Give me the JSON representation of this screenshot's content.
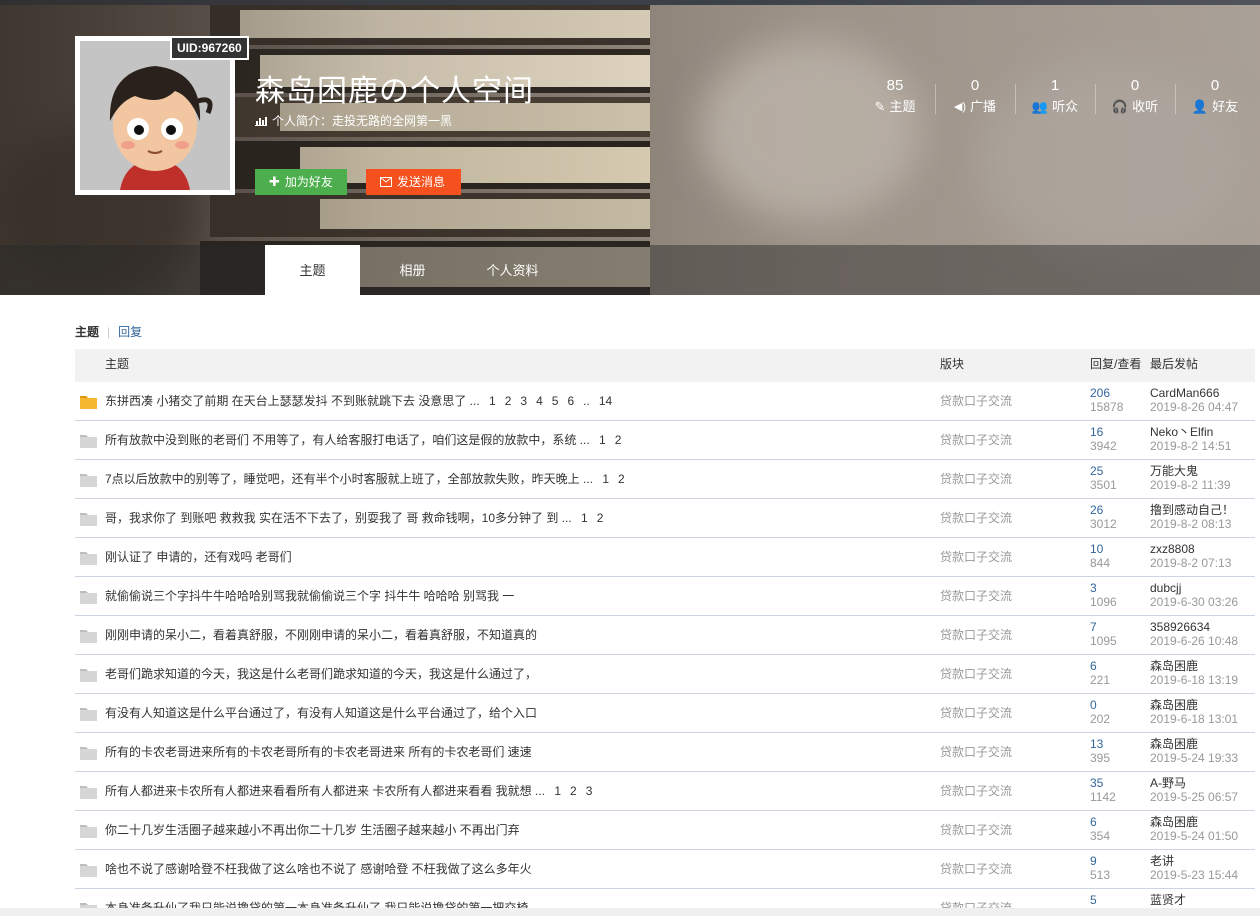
{
  "profile": {
    "uid": "UID:967260",
    "title": "森岛困鹿の个人空间",
    "bio": "个人简介：走投无路的全网第一黑",
    "add_friend": "加为好友",
    "send_msg": "发送消息"
  },
  "stats": [
    {
      "num": "85",
      "label": "主题",
      "icon": "pencil-icon"
    },
    {
      "num": "0",
      "label": "广播",
      "icon": "broadcast-icon"
    },
    {
      "num": "1",
      "label": "听众",
      "icon": "users-icon"
    },
    {
      "num": "0",
      "label": "收听",
      "icon": "headphones-icon"
    },
    {
      "num": "0",
      "label": "好友",
      "icon": "user-icon"
    }
  ],
  "tabs": [
    {
      "label": "主题",
      "active": true
    },
    {
      "label": "相册",
      "active": false
    },
    {
      "label": "个人资料",
      "active": false
    }
  ],
  "subnav": {
    "current": "主题",
    "other": "回复"
  },
  "table": {
    "headers": {
      "subject": "主题",
      "forum": "版块",
      "counts": "回复/查看",
      "last": "最后发帖"
    },
    "rows": [
      {
        "subject": "东拼西凑 小猪交了前期 在天台上瑟瑟发抖 不到账就跳下去 没意思了 ...",
        "pages": [
          "1",
          "2",
          "3",
          "4",
          "5",
          "6",
          "..",
          "14"
        ],
        "forum": "贷款口子交流",
        "replies": "206",
        "views": "15878",
        "last_user": "CardMan666",
        "last_time": "2019-8-26 04:47",
        "hot": true
      },
      {
        "subject": "所有放款中没到账的老哥们 不用等了，有人给客服打电话了，咱们这是假的放款中，系统 ...",
        "pages": [
          "1",
          "2"
        ],
        "forum": "贷款口子交流",
        "replies": "16",
        "views": "3942",
        "last_user": "Neko丶Elfin",
        "last_time": "2019-8-2 14:51",
        "hot": false
      },
      {
        "subject": "7点以后放款中的别等了，睡觉吧，还有半个小时客服就上班了，全部放款失败，昨天晚上 ...",
        "pages": [
          "1",
          "2"
        ],
        "forum": "贷款口子交流",
        "replies": "25",
        "views": "3501",
        "last_user": "万能大鬼",
        "last_time": "2019-8-2 11:39",
        "hot": false
      },
      {
        "subject": "哥，我求你了 到账吧 救救我 实在活不下去了，别耍我了 哥 救命钱啊，10多分钟了 到 ...",
        "pages": [
          "1",
          "2"
        ],
        "forum": "贷款口子交流",
        "replies": "26",
        "views": "3012",
        "last_user": "撸到感动自己！",
        "last_time": "2019-8-2 08:13",
        "hot": false
      },
      {
        "subject": "刚认证了 申请的，还有戏吗 老哥们",
        "pages": [],
        "forum": "贷款口子交流",
        "replies": "10",
        "views": "844",
        "last_user": "zxz8808",
        "last_time": "2019-8-2 07:13",
        "hot": false
      },
      {
        "subject": "就偷偷说三个字抖牛牛哈哈哈别骂我就偷偷说三个字 抖牛牛 哈哈哈 别骂我 一",
        "pages": [],
        "forum": "贷款口子交流",
        "replies": "3",
        "views": "1096",
        "last_user": "dubcjj",
        "last_time": "2019-6-30 03:26",
        "hot": false
      },
      {
        "subject": "刚刚申请的呆小二，看着真舒服，不刚刚申请的呆小二，看着真舒服，不知道真的",
        "pages": [],
        "forum": "贷款口子交流",
        "replies": "7",
        "views": "1095",
        "last_user": "358926634",
        "last_time": "2019-6-26 10:48",
        "hot": false
      },
      {
        "subject": "老哥们跪求知道的今天，我这是什么老哥们跪求知道的今天，我这是什么通过了，",
        "pages": [],
        "forum": "贷款口子交流",
        "replies": "6",
        "views": "221",
        "last_user": "森岛困鹿",
        "last_time": "2019-6-18 13:19",
        "hot": false
      },
      {
        "subject": "有没有人知道这是什么平台通过了，有没有人知道这是什么平台通过了，给个入口",
        "pages": [],
        "forum": "贷款口子交流",
        "replies": "0",
        "views": "202",
        "last_user": "森岛困鹿",
        "last_time": "2019-6-18 13:01",
        "hot": false
      },
      {
        "subject": "所有的卡农老哥进来所有的卡农老哥所有的卡农老哥进来 所有的卡农老哥们 速速",
        "pages": [],
        "forum": "贷款口子交流",
        "replies": "13",
        "views": "395",
        "last_user": "森岛困鹿",
        "last_time": "2019-5-24 19:33",
        "hot": false
      },
      {
        "subject": "所有人都进来卡农所有人都进来看看所有人都进来 卡农所有人都进来看看 我就想 ...",
        "pages": [
          "1",
          "2",
          "3"
        ],
        "forum": "贷款口子交流",
        "replies": "35",
        "views": "1142",
        "last_user": "A-野马",
        "last_time": "2019-5-25 06:57",
        "hot": false
      },
      {
        "subject": "你二十几岁生活圈子越来越小不再出你二十几岁 生活圈子越来越小 不再出门弃",
        "pages": [],
        "forum": "贷款口子交流",
        "replies": "6",
        "views": "354",
        "last_user": "森岛困鹿",
        "last_time": "2019-5-24 01:50",
        "hot": false
      },
      {
        "subject": "啥也不说了感谢哈登不枉我做了这么啥也不说了 感谢哈登 不枉我做了这么多年火",
        "pages": [],
        "forum": "贷款口子交流",
        "replies": "9",
        "views": "513",
        "last_user": "老讲",
        "last_time": "2019-5-23 15:44",
        "hot": false
      },
      {
        "subject": "本身准备升仙了我只能说撸贷的第一本身准备升仙了 我只能说撸贷的第一把交椅",
        "pages": [],
        "forum": "贷款口子交流",
        "replies": "5",
        "views": "",
        "last_user": "蓝贤才",
        "last_time": "",
        "hot": false
      }
    ]
  }
}
